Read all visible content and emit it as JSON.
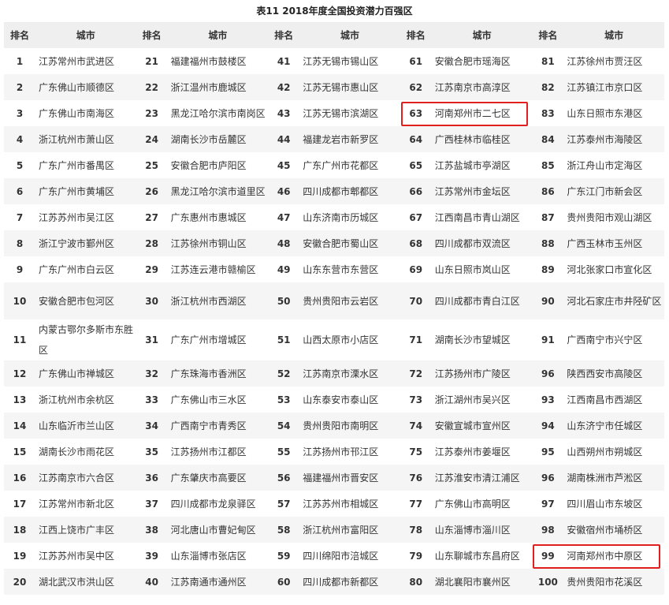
{
  "title": "表11 2018年度全国投资潜力百强区",
  "headers": {
    "rank": "排名",
    "city": "城市"
  },
  "highlight_color": "#e01f1f",
  "row_background_alt": "#f5f5f5",
  "header_background": "#efefef",
  "columns": [
    {
      "ranks": [
        "1",
        "2",
        "3",
        "4",
        "5",
        "6",
        "7",
        "8",
        "9",
        "10",
        "11",
        "12",
        "13",
        "14",
        "15",
        "16",
        "17",
        "18",
        "19",
        "20"
      ],
      "cities": [
        "江苏常州市武进区",
        "广东佛山市顺德区",
        "广东佛山市南海区",
        "浙江杭州市萧山区",
        "广东广州市番禺区",
        "广东广州市黄埔区",
        "江苏苏州市吴江区",
        "浙江宁波市鄞州区",
        "广东广州市白云区",
        "安徽合肥市包河区",
        "内蒙古鄂尔多斯市东胜区",
        "广东佛山市禅城区",
        "浙江杭州市余杭区",
        "山东临沂市兰山区",
        "湖南长沙市雨花区",
        "江苏南京市六合区",
        "江苏常州市新北区",
        "江西上饶市广丰区",
        "江苏苏州市吴中区",
        "湖北武汉市洪山区"
      ]
    },
    {
      "ranks": [
        "21",
        "22",
        "23",
        "24",
        "25",
        "26",
        "27",
        "28",
        "29",
        "30",
        "31",
        "32",
        "33",
        "34",
        "35",
        "36",
        "37",
        "38",
        "39",
        "40"
      ],
      "cities": [
        "福建福州市鼓楼区",
        "浙江温州市鹿城区",
        "黑龙江哈尔滨市南岗区",
        "湖南长沙市岳麓区",
        "安徽合肥市庐阳区",
        "黑龙江哈尔滨市道里区",
        "广东惠州市惠城区",
        "江苏徐州市铜山区",
        "江苏连云港市赣榆区",
        "浙江杭州市西湖区",
        "广东广州市增城区",
        "广东珠海市香洲区",
        "广东佛山市三水区",
        "广西南宁市青秀区",
        "江苏扬州市江都区",
        "广东肇庆市高要区",
        "四川成都市龙泉驿区",
        "河北唐山市曹妃甸区",
        "山东淄博市张店区",
        "江苏南通市通州区"
      ]
    },
    {
      "ranks": [
        "41",
        "42",
        "43",
        "44",
        "45",
        "46",
        "47",
        "48",
        "49",
        "50",
        "51",
        "52",
        "53",
        "54",
        "55",
        "56",
        "57",
        "58",
        "59",
        "60"
      ],
      "cities": [
        "江苏无锡市锡山区",
        "江苏无锡市惠山区",
        "江苏无锡市滨湖区",
        "福建龙岩市新罗区",
        "广东广州市花都区",
        "四川成都市郫都区",
        "山东济南市历城区",
        "安徽合肥市蜀山区",
        "山东东营市东营区",
        "贵州贵阳市云岩区",
        "山西太原市小店区",
        "江苏南京市溧水区",
        "山东泰安市泰山区",
        "贵州贵阳市南明区",
        "江苏扬州市邗江区",
        "福建福州市晋安区",
        "江苏苏州市相城区",
        "浙江杭州市富阳区",
        "四川绵阳市涪城区",
        "四川成都市新都区"
      ]
    },
    {
      "ranks": [
        "61",
        "62",
        "63",
        "64",
        "65",
        "66",
        "67",
        "68",
        "69",
        "70",
        "71",
        "72",
        "73",
        "74",
        "75",
        "76",
        "77",
        "78",
        "79",
        "80"
      ],
      "cities": [
        "安徽合肥市瑶海区",
        "江苏南京市高淳区",
        "河南郑州市二七区",
        "广西桂林市临桂区",
        "江苏盐城市亭湖区",
        "江苏常州市金坛区",
        "江西南昌市青山湖区",
        "四川成都市双流区",
        "山东日照市岚山区",
        "四川成都市青白江区",
        "湖南长沙市望城区",
        "江苏扬州市广陵区",
        "浙江湖州市吴兴区",
        "安徽宣城市宣州区",
        "江苏泰州市姜堰区",
        "江苏淮安市清江浦区",
        "广东佛山市高明区",
        "山东淄博市淄川区",
        "山东聊城市东昌府区",
        "湖北襄阳市襄州区"
      ]
    },
    {
      "ranks": [
        "81",
        "82",
        "83",
        "84",
        "85",
        "86",
        "87",
        "88",
        "89",
        "90",
        "91",
        "96",
        "93",
        "94",
        "95",
        "96",
        "97",
        "98",
        "99",
        "100"
      ],
      "cities": [
        "江苏徐州市贾汪区",
        "江苏镇江市京口区",
        "山东日照市东港区",
        "江苏泰州市海陵区",
        "浙江舟山市定海区",
        "广东江门市新会区",
        "贵州贵阳市观山湖区",
        "广西玉林市玉州区",
        "河北张家口市宣化区",
        "河北石家庄市井陉矿区",
        "广西南宁市兴宁区",
        "陕西西安市高陵区",
        "江西南昌市西湖区",
        "山东济宁市任城区",
        "山西朔州市朔城区",
        "湖南株洲市芦淞区",
        "四川眉山市东坡区",
        "安徽宿州市埇桥区",
        "河南郑州市中原区",
        "贵州贵阳市花溪区"
      ]
    }
  ]
}
